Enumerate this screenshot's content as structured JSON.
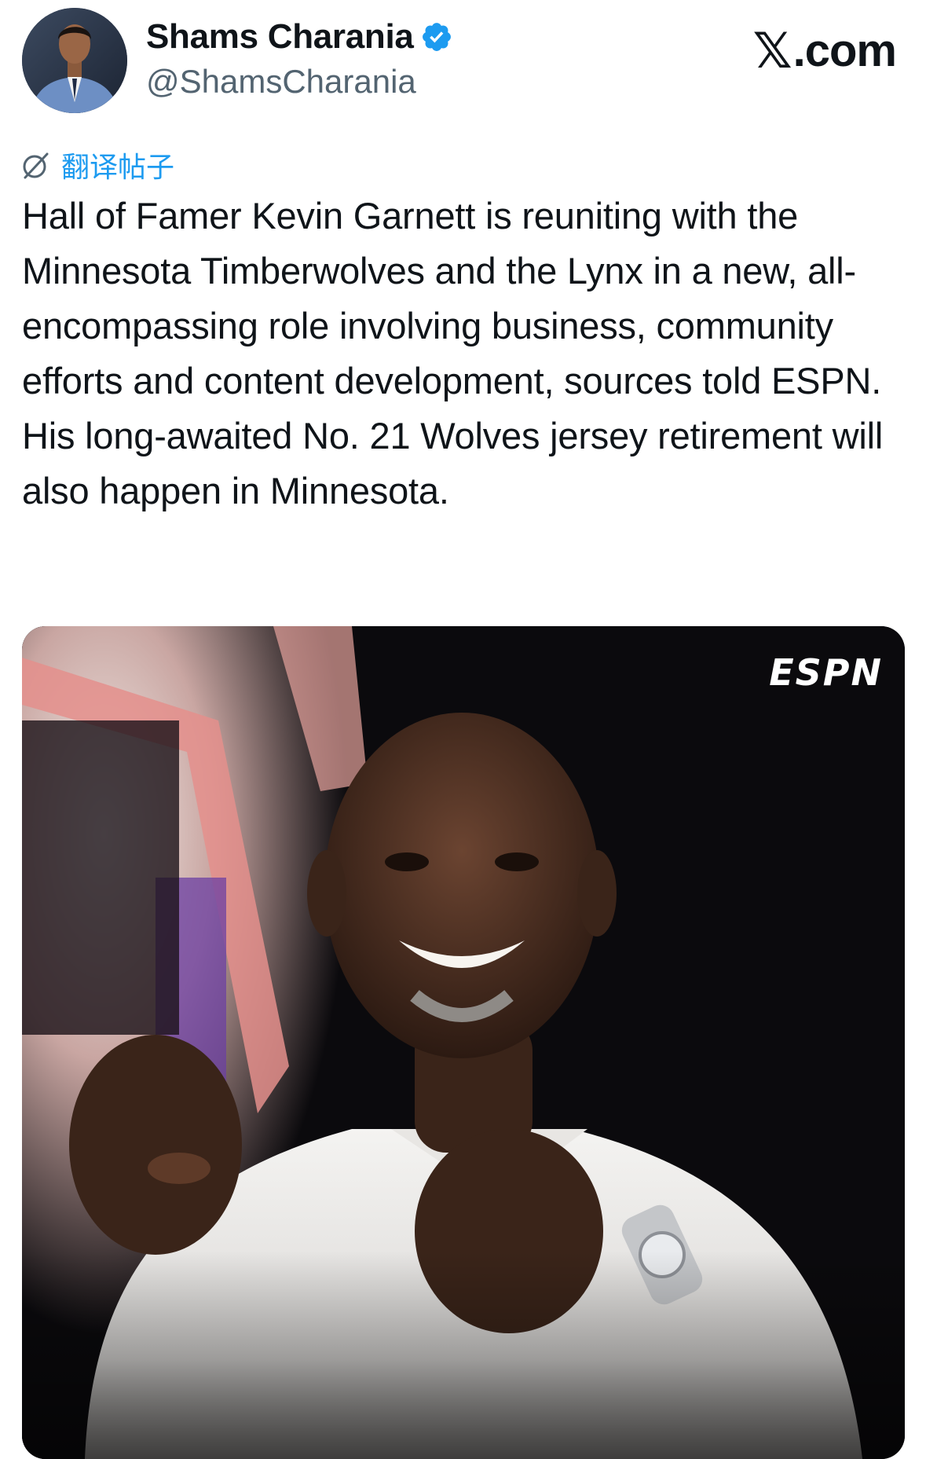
{
  "author": {
    "name": "Shams Charania",
    "handle": "@ShamsCharania",
    "verified": true,
    "verified_color": "#1d9bf0"
  },
  "brand": {
    "mark": "𝕏",
    "suffix": ".com"
  },
  "translate": {
    "label": "翻译帖子",
    "icon": "translate-icon"
  },
  "post": {
    "text": "Hall of Famer Kevin Garnett is reuniting with the Minnesota Timberwolves and the Lynx in a new, all-encompassing role involving business, community efforts and content development, sources told ESPN. His long-awaited No. 21 Wolves jersey retirement will also happen in Minnesota."
  },
  "media": {
    "watermark": "ESPN"
  },
  "colors": {
    "text": "#0f1419",
    "secondary": "#536471",
    "link": "#1d9bf0",
    "background": "#ffffff"
  }
}
